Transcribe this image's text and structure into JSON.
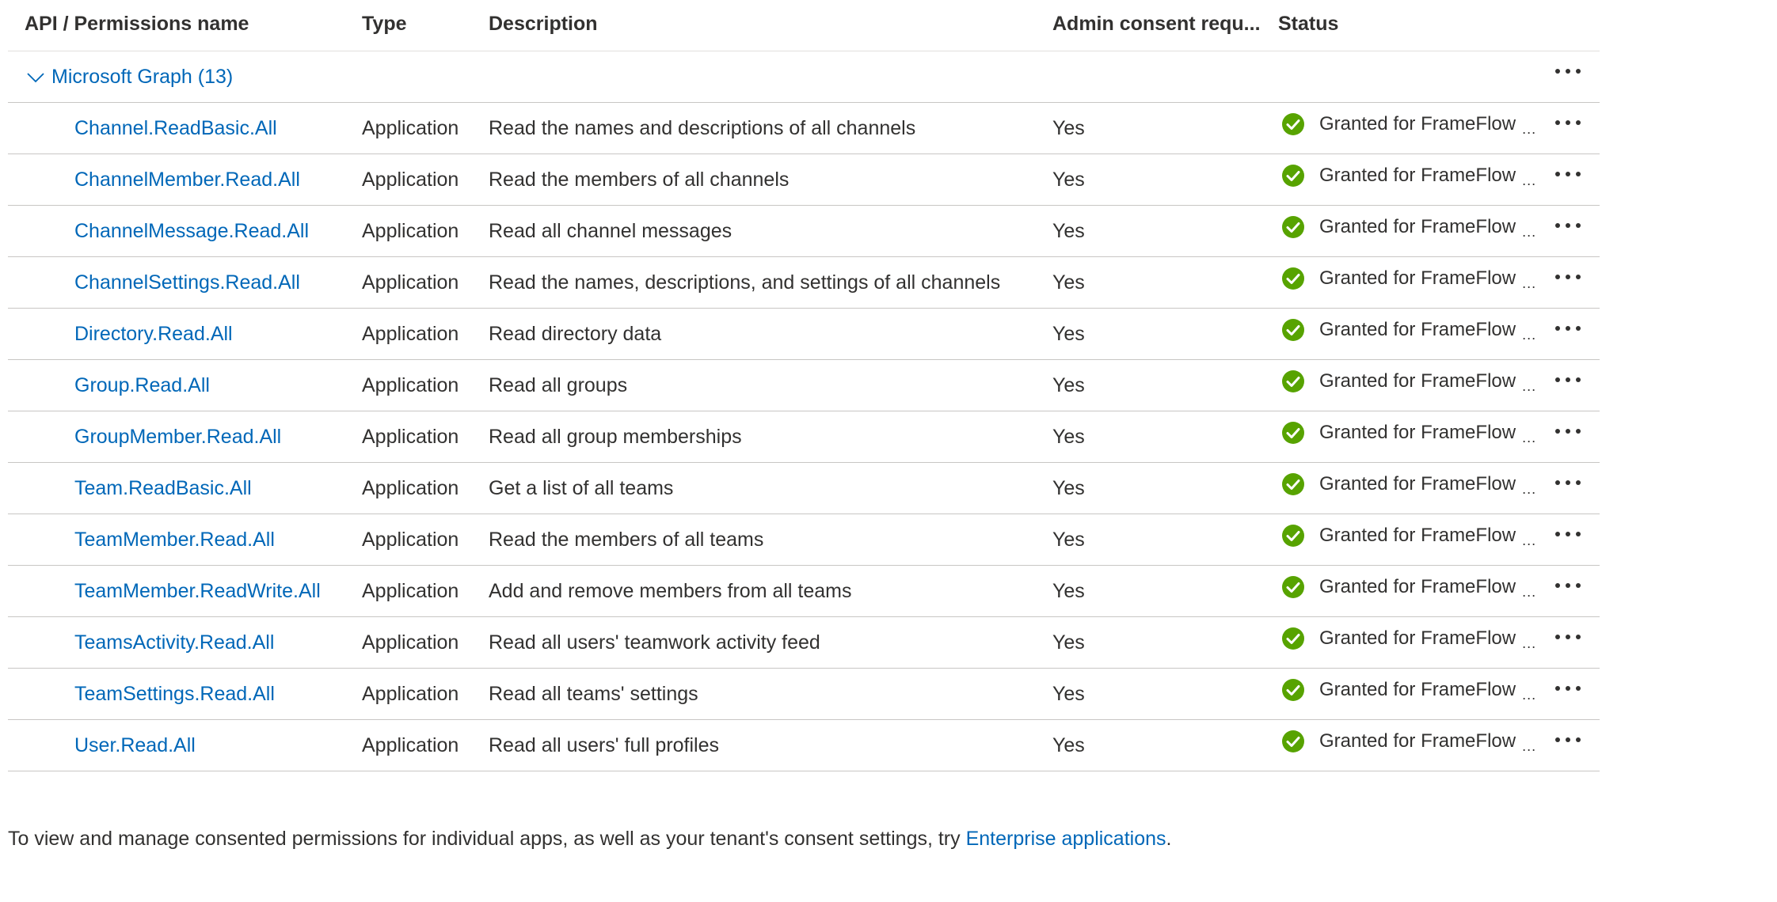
{
  "headers": {
    "name": "API / Permissions name",
    "type": "Type",
    "description": "Description",
    "admin_consent": "Admin consent requ...",
    "status": "Status"
  },
  "group": {
    "label": "Microsoft Graph (13)",
    "expanded": true
  },
  "permissions": [
    {
      "name": "Channel.ReadBasic.All",
      "type": "Application",
      "description": "Read the names and descriptions of all channels",
      "admin_consent": "Yes",
      "status": "Granted for FrameFlow"
    },
    {
      "name": "ChannelMember.Read.All",
      "type": "Application",
      "description": "Read the members of all channels",
      "admin_consent": "Yes",
      "status": "Granted for FrameFlow"
    },
    {
      "name": "ChannelMessage.Read.All",
      "type": "Application",
      "description": "Read all channel messages",
      "admin_consent": "Yes",
      "status": "Granted for FrameFlow"
    },
    {
      "name": "ChannelSettings.Read.All",
      "type": "Application",
      "description": "Read the names, descriptions, and settings of all channels",
      "admin_consent": "Yes",
      "status": "Granted for FrameFlow"
    },
    {
      "name": "Directory.Read.All",
      "type": "Application",
      "description": "Read directory data",
      "admin_consent": "Yes",
      "status": "Granted for FrameFlow"
    },
    {
      "name": "Group.Read.All",
      "type": "Application",
      "description": "Read all groups",
      "admin_consent": "Yes",
      "status": "Granted for FrameFlow"
    },
    {
      "name": "GroupMember.Read.All",
      "type": "Application",
      "description": "Read all group memberships",
      "admin_consent": "Yes",
      "status": "Granted for FrameFlow"
    },
    {
      "name": "Team.ReadBasic.All",
      "type": "Application",
      "description": "Get a list of all teams",
      "admin_consent": "Yes",
      "status": "Granted for FrameFlow"
    },
    {
      "name": "TeamMember.Read.All",
      "type": "Application",
      "description": "Read the members of all teams",
      "admin_consent": "Yes",
      "status": "Granted for FrameFlow"
    },
    {
      "name": "TeamMember.ReadWrite.All",
      "type": "Application",
      "description": "Add and remove members from all teams",
      "admin_consent": "Yes",
      "status": "Granted for FrameFlow"
    },
    {
      "name": "TeamsActivity.Read.All",
      "type": "Application",
      "description": "Read all users' teamwork activity feed",
      "admin_consent": "Yes",
      "status": "Granted for FrameFlow"
    },
    {
      "name": "TeamSettings.Read.All",
      "type": "Application",
      "description": "Read all teams' settings",
      "admin_consent": "Yes",
      "status": "Granted for FrameFlow"
    },
    {
      "name": "User.Read.All",
      "type": "Application",
      "description": "Read all users' full profiles",
      "admin_consent": "Yes",
      "status": "Granted for FrameFlow"
    }
  ],
  "status_truncation": "...",
  "icons": {
    "status": "check-circle-icon",
    "more": "more-horizontal-icon",
    "expand": "chevron-down-icon"
  },
  "colors": {
    "link": "#0067b8",
    "success": "#57a300"
  },
  "footer": {
    "text": "To view and manage consented permissions for individual apps, as well as your tenant's consent settings, try ",
    "link": "Enterprise applications",
    "end": "."
  }
}
